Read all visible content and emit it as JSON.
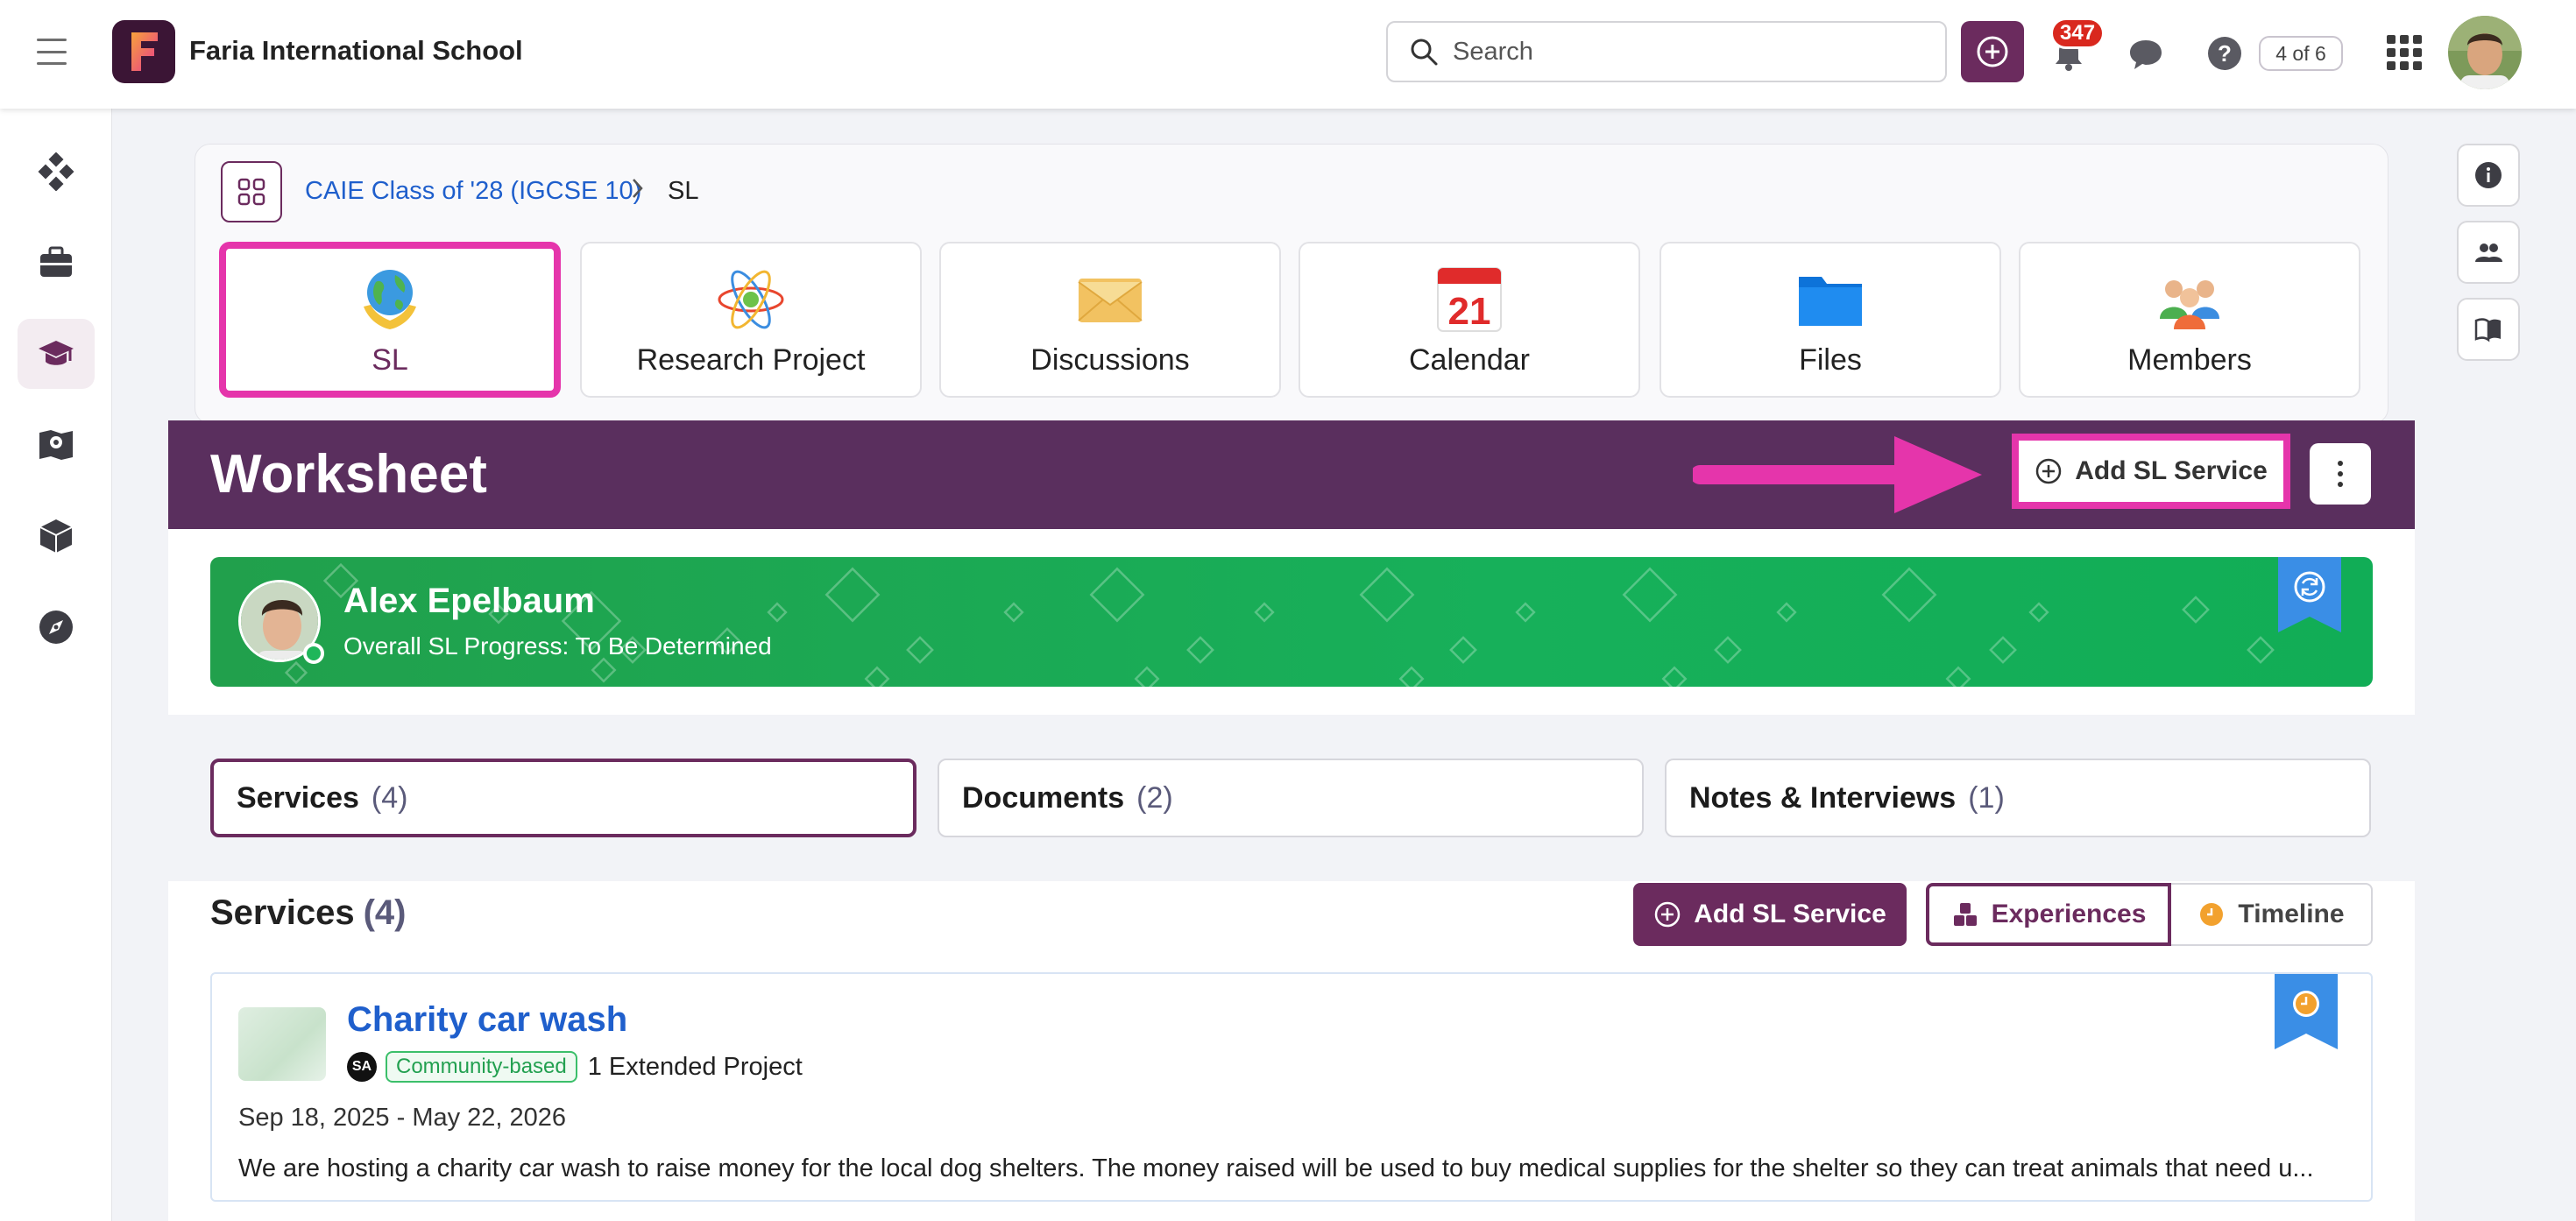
{
  "app": {
    "school_name": "Faria International School",
    "search_placeholder": "Search",
    "notification_count": "347",
    "pager": "4 of 6"
  },
  "sidebar": {
    "items": [
      {
        "name": "dashboard-icon"
      },
      {
        "name": "briefcase-icon"
      },
      {
        "name": "graduation-cap-icon",
        "active": true
      },
      {
        "name": "map-book-icon"
      },
      {
        "name": "cube-icon"
      },
      {
        "name": "compass-icon"
      }
    ]
  },
  "right_rail": [
    "info-icon",
    "people-icon",
    "book-icon"
  ],
  "breadcrumb": {
    "parent": "CAIE Class of '28 (IGCSE 10)",
    "separator": ">",
    "current": "SL"
  },
  "tiles": [
    {
      "label": "SL",
      "icon": "globe-hands-icon",
      "selected": true
    },
    {
      "label": "Research Project",
      "icon": "atom-icon"
    },
    {
      "label": "Discussions",
      "icon": "envelope-icon"
    },
    {
      "label": "Calendar",
      "icon": "calendar-icon",
      "day": "21"
    },
    {
      "label": "Files",
      "icon": "folder-icon"
    },
    {
      "label": "Members",
      "icon": "members-icon"
    }
  ],
  "worksheet": {
    "title": "Worksheet",
    "add_button": "Add SL Service"
  },
  "student": {
    "name": "Alex Epelbaum",
    "progress": "Overall SL Progress: To Be Determined"
  },
  "tabs": [
    {
      "label": "Services",
      "count": "(4)",
      "active": true
    },
    {
      "label": "Documents",
      "count": "(2)"
    },
    {
      "label": "Notes & Interviews",
      "count": "(1)"
    }
  ],
  "services_section": {
    "title": "Services",
    "count": "(4)",
    "add_button": "Add SL Service",
    "view_experiences": "Experiences",
    "view_timeline": "Timeline"
  },
  "service": {
    "title": "Charity car wash",
    "owner_initials": "SA",
    "category": "Community-based",
    "project": "1 Extended Project",
    "dates": "Sep 18, 2025 - May 22, 2026",
    "description": "We are hosting a charity car wash to raise money for the local dog shelters. The money raised will be used to buy medical supplies for the shelter so they can treat animals that need u..."
  },
  "colors": {
    "brand_purple": "#6b2b5e",
    "worksheet_bar": "#5a2f5e",
    "highlight_pink": "#e535ab",
    "banner_green": "#17b05a",
    "link_blue": "#1f5fcc",
    "ribbon_blue": "#3a8ee6"
  }
}
